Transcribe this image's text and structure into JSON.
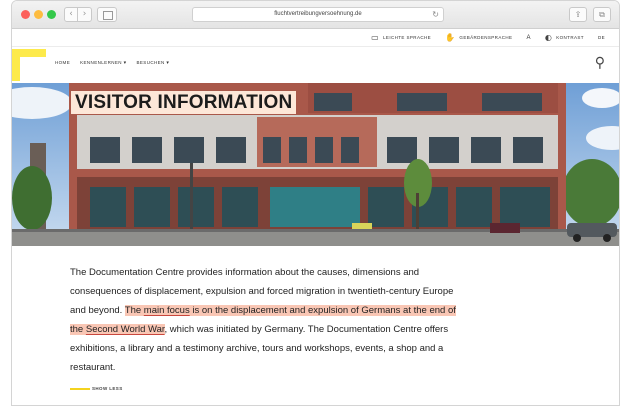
{
  "browser": {
    "url": "fluchtvertreibungversoehnung.de",
    "back_icon": "chevron-left-icon",
    "forward_icon": "chevron-right-icon",
    "reload_icon": "reload-icon"
  },
  "accessibility_bar": {
    "items": [
      {
        "label": "LEICHTE SPRACHE",
        "icon": "book-icon"
      },
      {
        "label": "GEBÄRDENSPRACHE",
        "icon": "sign-language-icon"
      },
      {
        "label": "A",
        "icon": "font-size-icon"
      },
      {
        "label": "KONTRAST",
        "icon": "contrast-icon"
      },
      {
        "label": "DE",
        "icon": ""
      }
    ]
  },
  "nav": {
    "items": [
      {
        "label": "HOME"
      },
      {
        "label": "KENNENLERNEN"
      },
      {
        "label": "BESUCHEN"
      }
    ],
    "search_icon": "search-icon"
  },
  "hero": {
    "title": "VISITOR INFORMATION"
  },
  "content": {
    "p1": "The Documentation Centre provides information about the causes, dimensions and consequences of displacement, expulsion and forced migration in twentieth-century Europe and beyond. ",
    "hl1": "The ",
    "hl_link1": "main focus",
    "hl2": " is on the displacement and expulsion of Germans at the end of the ",
    "hl_link2": "Second World War",
    "p2": ", which was initiated by Germany. The Documentation Centre offers exhibitions, a library and a testimony archive, tours and workshops, events, a shop and a restaurant."
  },
  "show_less": "SHOW LESS",
  "colors": {
    "accent_yellow": "#fdea4b",
    "highlight": "#f9c6b4",
    "title_bg": "#fde7d8"
  }
}
